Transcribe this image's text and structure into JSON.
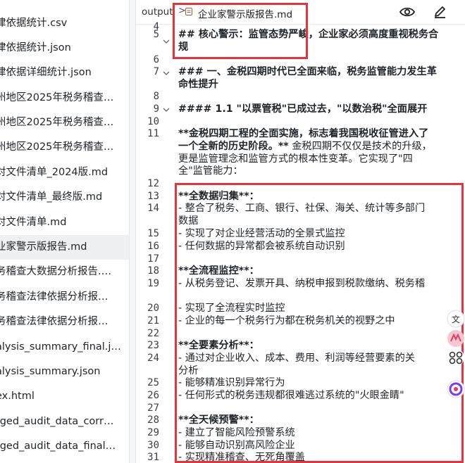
{
  "sidebar": {
    "items": [
      {
        "label": "律依据统计.csv",
        "active": false
      },
      {
        "label": "律依据统计.json",
        "active": false
      },
      {
        "label": "律依据详细统计.json",
        "active": false
      },
      {
        "label": "州地区2025年税务稽查…",
        "active": false
      },
      {
        "label": "州地区2025年税务稽查…",
        "active": false
      },
      {
        "label": "州地区2025年税务稽查…",
        "active": false
      },
      {
        "label": "对文件清单_2024版.md",
        "active": false
      },
      {
        "label": "对文件清单_最终版.md",
        "active": false
      },
      {
        "label": "对文件清单.md",
        "active": false
      },
      {
        "label": "业家警示版报告.md",
        "active": true
      },
      {
        "label": "务稽查大数据分析报告.…",
        "active": false
      },
      {
        "label": "务稽查法律依据分析报…",
        "active": false
      },
      {
        "label": "务稽查法律依据分析报…",
        "active": false
      },
      {
        "label": "alysis_summary_final.j…",
        "active": false
      },
      {
        "label": "alysis_summary.json",
        "active": false
      },
      {
        "label": "ex.html",
        "active": false
      },
      {
        "label": "rged_audit_data_corr…",
        "active": false
      },
      {
        "label": "rged_audit_data_final…",
        "active": false
      }
    ]
  },
  "editor": {
    "breadcrumb_root": "output",
    "breadcrumb_sep": ">",
    "file_name": "企业家警示版报告.md",
    "preview_icon": "eye-icon",
    "edit_icon": "pencil-icon"
  },
  "line_numbers": [
    "4",
    "5",
    "6",
    "7",
    "8",
    "9",
    "10",
    "11",
    "12",
    "13",
    "14",
    "15",
    "16",
    "17",
    "18",
    "19",
    "20",
    "21",
    "22",
    "23",
    "24",
    "25",
    "26",
    "27",
    "28",
    "29",
    "30",
    "31"
  ],
  "lines": {
    "l5a": "## 核心警示：监管态势严峻，企业家必须高度重视税务合",
    "l5b": "规",
    "l7a": "### 一、金税四期时代已全面来临，税务监管能力发生革",
    "l7b": "命性提升",
    "l9": "#### 1.1 \"以票管税\"已成过去，\"以数治税\"全面展开",
    "l11a": "**金税四期工程的全面实施，标志着我国税收征管进入了",
    "l11b": "一个全新的历史阶段。**",
    "l11c": "金税四期不仅仅是技术的升级，",
    "l11d": "更是监管理念和监管方式的根本性变革。它实现了\"四",
    "l11e": "全\"监管能力：",
    "l13": "**全数据归集**：",
    "l14a": "- 整合了税务、工商、银行、社保、海关、统计等多部门",
    "l14b": "数据",
    "l15": "- 实现了对企业经营活动的全景式监控",
    "l16": "- 任何数据的异常都会被系统自动识别",
    "l18": "**全流程监控**：",
    "l19": "- 从税务登记、发票开具、纳税申报到税款缴纳、税务稽",
    "l20": "- 实现了全流程实时监控",
    "l21": "- 企业的每一个税务行为都在税务机关的视野之中",
    "l23": "**全要素分析**：",
    "l24a": "- 通过对企业收入、成本、费用、利润等经营要素的关",
    "l24b": "分析",
    "l25": "- 能够精准识别异常行为",
    "l26": "- 任何形式的税务违规都很难逃过系统的\"火眼金睛\"",
    "l28": "**全天候预警**：",
    "l29": "- 建立了智能风险预警系统",
    "l30": "- 能够自动识别高风险企业",
    "l31": "- 实现精准稽查、无死角覆盖"
  },
  "floating_icons": [
    "translate-icon",
    "brand-badge-icon",
    "nodes-icon",
    "assistant-orb-icon"
  ],
  "colors": {
    "annotation_red": "#e3343f",
    "active_row": "#eef0f3"
  }
}
